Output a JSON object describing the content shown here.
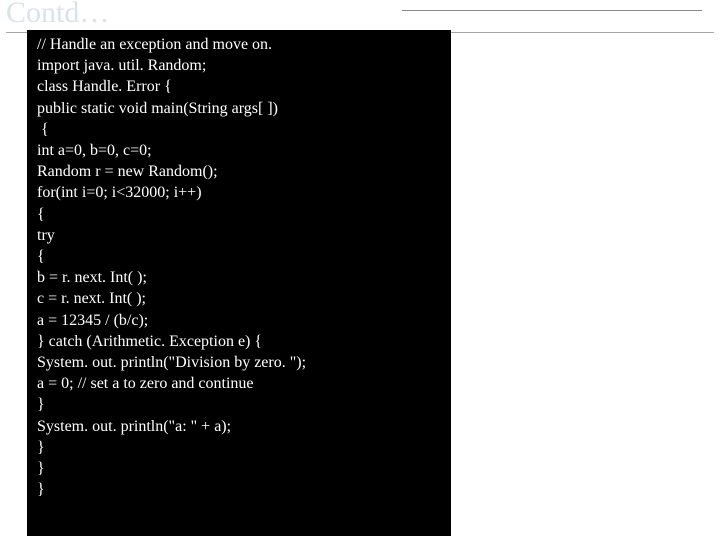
{
  "title": "Contd…",
  "code": [
    " // Handle an exception and move on.",
    " import java. util. Random;",
    " class Handle. Error {",
    " public static void main(String args[ ])",
    "  {",
    " int a=0, b=0, c=0;",
    " Random r = new Random();",
    " for(int i=0; i<32000; i++)",
    " {",
    " try",
    " {",
    " b = r. next. Int( );",
    " c = r. next. Int( );",
    " a = 12345 / (b/c);",
    " } catch (Arithmetic. Exception e) {",
    " System. out. println(\"Division by zero. \");",
    " a = 0; // set a to zero and continue",
    " }",
    " System. out. println(\"a: \" + a);",
    " }",
    " }",
    " }"
  ]
}
